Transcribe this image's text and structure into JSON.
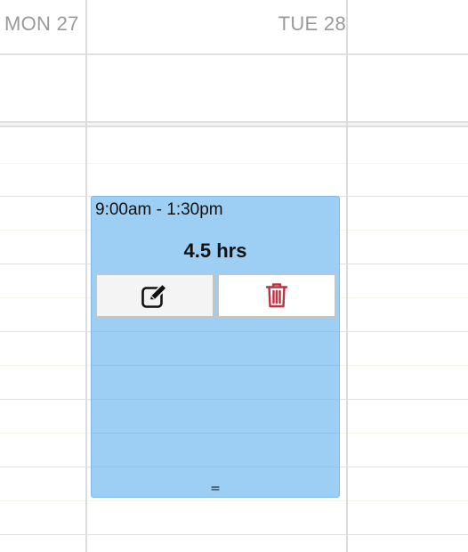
{
  "header": {
    "days": [
      {
        "label": "MON 27"
      },
      {
        "label": "TUE 28"
      }
    ]
  },
  "event": {
    "time_range": "9:00am - 1:30pm",
    "duration": "4.5 hrs",
    "color": "#9ccff3",
    "edit_icon": "pencil-square-icon",
    "delete_icon": "trash-icon",
    "delete_color": "#c0303e",
    "resize_handle": "="
  }
}
